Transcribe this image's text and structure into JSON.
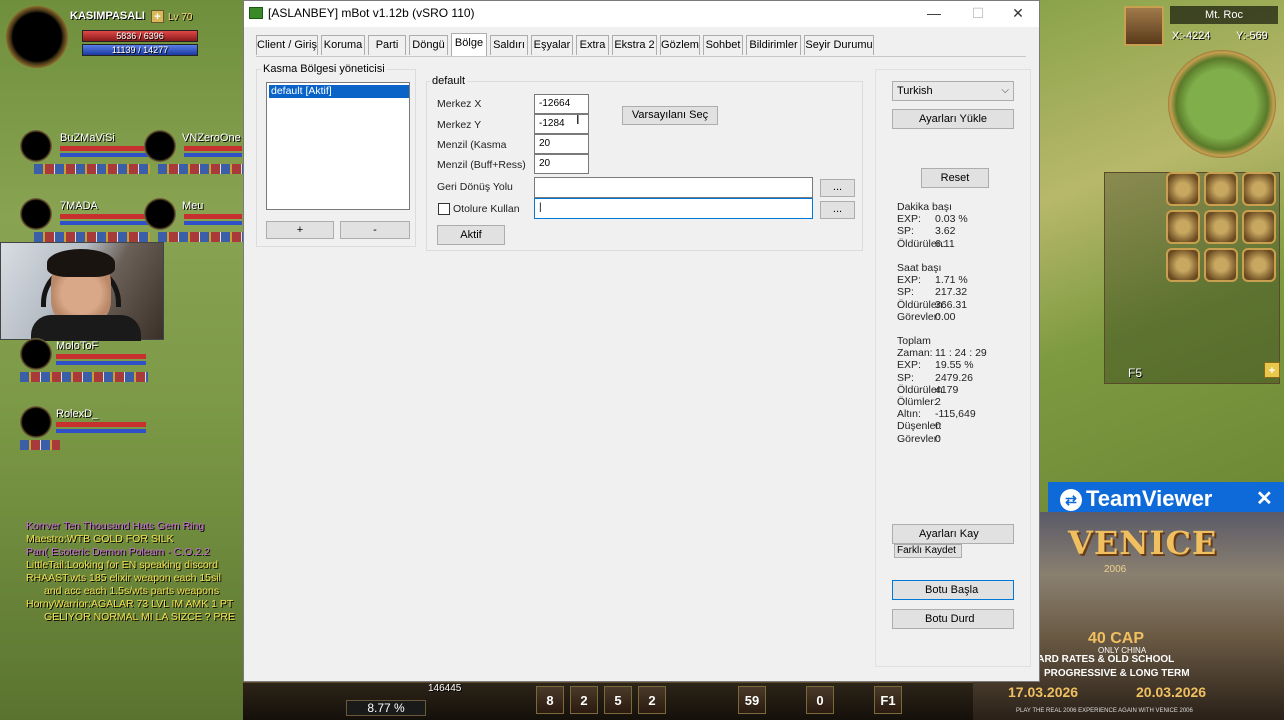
{
  "game": {
    "player": {
      "name": "KASIMPASALI",
      "level": "Lv 70",
      "hp": "5836 / 6396",
      "mp": "11139 / 14277"
    },
    "party": [
      {
        "name": "BuZMaViSi"
      },
      {
        "name": "VNZeroOne"
      },
      {
        "name": "7MADA"
      },
      {
        "name": "Meu"
      },
      {
        "name": "MoloToF"
      },
      {
        "name": "RolexD_"
      }
    ],
    "chat": [
      {
        "text": "Korrver  Ten Thousand Hats Gem Ring",
        "color": "#c86ad8"
      },
      {
        "text": "Maestro:WTB GOLD FOR SILK",
        "color": "#f0e050"
      },
      {
        "text": "Pan(   Esoteric Demon Poleam  - C.O.2.2",
        "color": "#c86ad8"
      },
      {
        "text": "LittleTail:Looking for EN speaking discord",
        "color": "#f0e050"
      },
      {
        "text": "RHAAST:wts 185 elixir weapon each 15sil",
        "color": "#f0e050"
      },
      {
        "text": "and acc each 1.5s/wts parts weapons",
        "color": "#f0e050"
      },
      {
        "text": "HornyWarrior:AGALAR 73 LVL IM AMK 1 PT",
        "color": "#f0e050"
      },
      {
        "text": "GELIYOR NORMAL MI LA SIZCE ? PRE",
        "color": "#f0e050"
      }
    ],
    "minimap": {
      "title": "Mt. Roc",
      "x": "X:-4224",
      "y": "Y:-569"
    },
    "skillbar_page": "F5",
    "exp_percent": "8.77 %",
    "gold_or_sp": "146445",
    "hotbar": [
      "8",
      "2",
      "5",
      "2",
      "59",
      "0",
      "F1"
    ]
  },
  "teamviewer": {
    "name": "TeamViewer",
    "close": "✕"
  },
  "ad": {
    "logo": "VENICE",
    "year": "2006",
    "cap": "40 CAP",
    "cap_sub": "ONLY CHINA",
    "line1": "HARD RATES & OLD SCHOOL",
    "line2": "PROGRESSIVE & LONG TERM",
    "date1": "17.03.2026",
    "date2": "20.03.2026",
    "footer": "PLAY THE REAL 2006 EXPERIENCE AGAIN WITH VENICE 2006"
  },
  "window": {
    "title": "[ASLANBEY] mBot v1.12b (vSRO 110)",
    "controls": {
      "minimize": "—",
      "maximize": "☐",
      "close": "✕"
    },
    "tabs": [
      "Client / Giriş",
      "Koruma",
      "Parti",
      "Döngü",
      "Bölge",
      "Saldırı",
      "Eşyalar",
      "Extra",
      "Ekstra 2",
      "Gözlem",
      "Sohbet",
      "Bildirimler",
      "Seyir Durumu"
    ],
    "active_tab": "Bölge",
    "zone_manager": {
      "title": "Kasma Bölgesi yöneticisi",
      "items": [
        "default [Aktif]"
      ],
      "add": "+",
      "remove": "-"
    },
    "zone": {
      "title": "default",
      "center_x_label": "Merkez X",
      "center_x": "-12664",
      "center_y_label": "Merkez Y",
      "center_y": "-1284",
      "range_kasma_label": "Menzil (Kasma",
      "range_kasma": "20",
      "range_buff_label": "Menzil (Buff+Ress)",
      "range_buff": "20",
      "default_btn": "Varsayılanı Seç",
      "return_path_label": "Geri Dönüş Yolu",
      "return_path": "",
      "browse": "...",
      "autolure_label": "Otolure Kullan",
      "autolure_path": "|",
      "activate": "Aktif"
    },
    "side": {
      "language": "Turkish",
      "load_settings": "Ayarları Yükle",
      "reset": "Reset",
      "per_minute": {
        "title": "Dakika başı",
        "rows": [
          {
            "label": "EXP:",
            "value": "0.03 %"
          },
          {
            "label": "SP:",
            "value": "3.62"
          },
          {
            "label": "Öldürülen:",
            "value": "6.11"
          }
        ]
      },
      "per_hour": {
        "title": "Saat başı",
        "rows": [
          {
            "label": "EXP:",
            "value": "1.71 %"
          },
          {
            "label": "SP:",
            "value": "217.32"
          },
          {
            "label": "Öldürülen:",
            "value": "366.31"
          },
          {
            "label": "Görevler:",
            "value": "0.00"
          }
        ]
      },
      "total": {
        "title": "Toplam",
        "rows": [
          {
            "label": "Zaman:",
            "value": "11 : 24 : 29"
          },
          {
            "label": "EXP:",
            "value": "19.55 %"
          },
          {
            "label": "SP:",
            "value": "2479.26"
          },
          {
            "label": "Öldürülen:",
            "value": "4179"
          },
          {
            "label": "Ölümler:",
            "value": "2"
          },
          {
            "label": "Altın:",
            "value": "-115,649"
          },
          {
            "label": "Düşenler:",
            "value": "0"
          },
          {
            "label": "Görevler:",
            "value": "0"
          }
        ]
      },
      "save_settings": "Ayarları Kay",
      "save_as": "Farklı Kaydet",
      "start_bot": "Botu Başla",
      "stop_bot": "Botu Durd"
    }
  }
}
